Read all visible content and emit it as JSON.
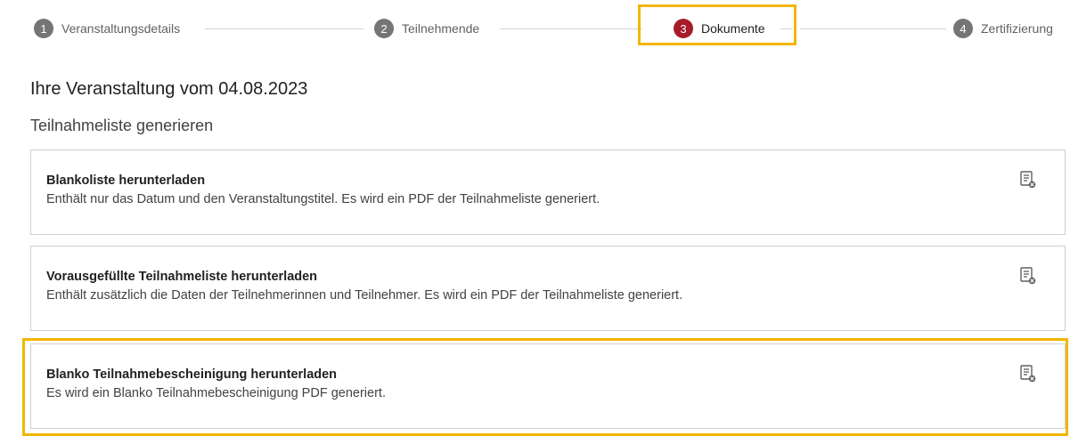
{
  "stepper": {
    "steps": [
      {
        "number": "1",
        "label": "Veranstaltungsdetails"
      },
      {
        "number": "2",
        "label": "Teilnehmende"
      },
      {
        "number": "3",
        "label": "Dokumente"
      },
      {
        "number": "4",
        "label": "Zertifizierung"
      }
    ],
    "active_step": 3
  },
  "page_title": "Ihre Veranstaltung vom 04.08.2023",
  "section_title": "Teilnahmeliste generieren",
  "cards": [
    {
      "title": "Blankoliste herunterladen",
      "description": "Enthält nur das Datum und den Veranstaltungstitel. Es wird ein PDF der Teilnahmeliste generiert.",
      "icon": "document-download-icon"
    },
    {
      "title": "Vorausgefüllte Teilnahmeliste herunterladen",
      "description": "Enthält zusätzlich die Daten der Teilnehmerinnen und Teilnehmer. Es wird ein PDF der Teilnahmeliste generiert.",
      "icon": "document-download-icon"
    },
    {
      "title": "Blanko Teilnahmebescheinigung herunterladen",
      "description": "Es wird ein Blanko Teilnahmebescheinigung PDF generiert.",
      "icon": "document-download-icon"
    }
  ],
  "colors": {
    "active_step": "#a81b2b",
    "inactive_step": "#757575",
    "highlight": "#f2b600",
    "border": "#cfcfcf"
  }
}
